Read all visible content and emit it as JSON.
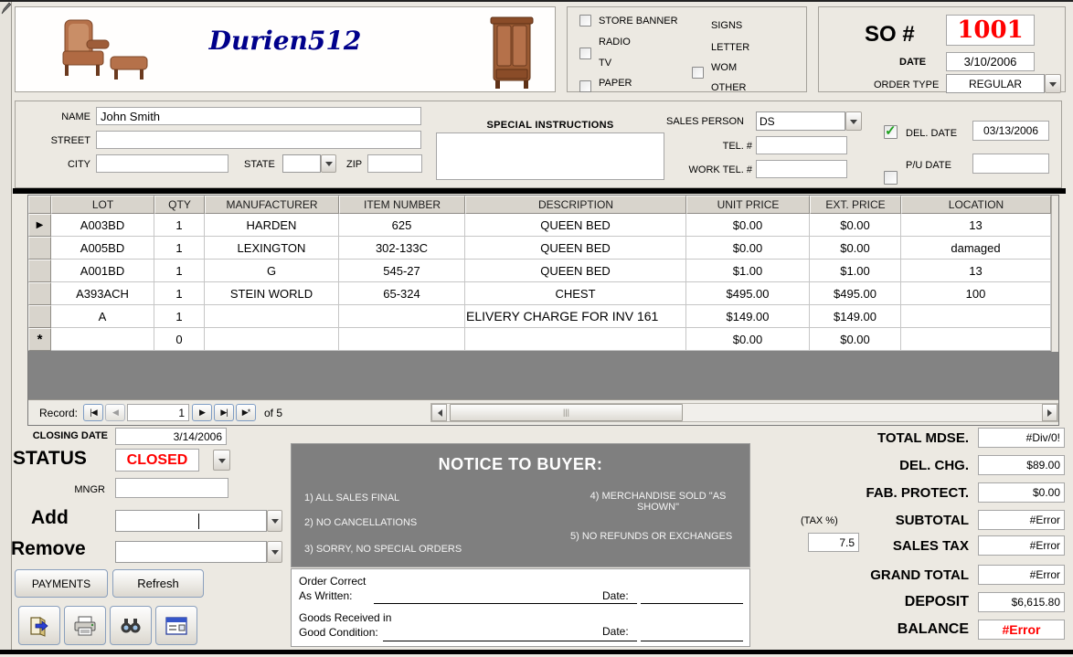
{
  "header": {
    "title": "Durien512",
    "images": [
      "armchair-image",
      "armoire-image"
    ],
    "checkboxes": [
      {
        "label": "STORE BANNER",
        "checked": false
      },
      {
        "label": "RADIO",
        "checked": false
      },
      {
        "label": "TV",
        "checked": false
      },
      {
        "label": "PAPER",
        "checked": false
      },
      {
        "label": "SIGNS",
        "checked": false
      },
      {
        "label": "LETTER",
        "checked": false
      },
      {
        "label": "WOM",
        "checked": true
      },
      {
        "label": "OTHER",
        "checked": false
      }
    ],
    "so": {
      "label": "SO #",
      "value": "1001"
    },
    "date": {
      "label": "DATE",
      "value": "3/10/2006"
    },
    "order_type": {
      "label": "ORDER TYPE",
      "value": "REGULAR"
    }
  },
  "customer": {
    "name": {
      "label": "NAME",
      "value": "John Smith"
    },
    "street": {
      "label": "STREET",
      "value": ""
    },
    "city": {
      "label": "CITY",
      "value": ""
    },
    "state": {
      "label": "STATE",
      "value": ""
    },
    "zip": {
      "label": "ZIP",
      "value": ""
    },
    "special_instructions": {
      "label": "SPECIAL INSTRUCTIONS",
      "value": ""
    },
    "sales_person": {
      "label": "SALES PERSON",
      "value": "DS"
    },
    "tel": {
      "label": "TEL. #",
      "value": ""
    },
    "work_tel": {
      "label": "WORK TEL. #",
      "value": ""
    },
    "del_date": {
      "label": "DEL. DATE",
      "checked": true,
      "value": "03/13/2006"
    },
    "pu_date": {
      "label": "P/U DATE",
      "checked": false,
      "value": ""
    }
  },
  "grid": {
    "columns": [
      "LOT",
      "QTY",
      "MANUFACTURER",
      "ITEM NUMBER",
      "DESCRIPTION",
      "UNIT PRICE",
      "EXT. PRICE",
      "LOCATION"
    ],
    "rows": [
      {
        "selector": "▶",
        "lot": "A003BD",
        "qty": "1",
        "manufacturer": "HARDEN",
        "item_number": "625",
        "description": "QUEEN BED",
        "unit_price": "$0.00",
        "ext_price": "$0.00",
        "location": "13"
      },
      {
        "selector": "",
        "lot": "A005BD",
        "qty": "1",
        "manufacturer": "LEXINGTON",
        "item_number": "302-133C",
        "description": "QUEEN BED",
        "unit_price": "$0.00",
        "ext_price": "$0.00",
        "location": "damaged"
      },
      {
        "selector": "",
        "lot": "A001BD",
        "qty": "1",
        "manufacturer": "G",
        "item_number": "545-27",
        "description": "QUEEN BED",
        "unit_price": "$1.00",
        "ext_price": "$1.00",
        "location": "13"
      },
      {
        "selector": "",
        "lot": "A393ACH",
        "qty": "1",
        "manufacturer": "STEIN WORLD",
        "item_number": "65-324",
        "description": "CHEST",
        "unit_price": "$495.00",
        "ext_price": "$495.00",
        "location": "100"
      },
      {
        "selector": "",
        "lot": "A",
        "qty": "1",
        "manufacturer": "",
        "item_number": "",
        "description": "ELIVERY CHARGE FOR INV 161",
        "unit_price": "$149.00",
        "ext_price": "$149.00",
        "location": ""
      },
      {
        "selector": "*",
        "lot": "",
        "qty": "0",
        "manufacturer": "",
        "item_number": "",
        "description": "",
        "unit_price": "$0.00",
        "ext_price": "$0.00",
        "location": ""
      }
    ],
    "record_nav": {
      "label": "Record:",
      "value": "1",
      "of_label": "of 5",
      "first": "|◀",
      "prev": "◀",
      "next": "▶",
      "last": "▶|",
      "new_rec": "▶*"
    }
  },
  "left_panel": {
    "closing_date": {
      "label": "CLOSING DATE",
      "value": "3/14/2006"
    },
    "status": {
      "label": "STATUS",
      "value": "CLOSED"
    },
    "mngr": {
      "label": "MNGR",
      "value": ""
    },
    "add": {
      "label": "Add",
      "value": ""
    },
    "remove": {
      "label": "Remove",
      "value": ""
    },
    "payments_button": "PAYMENTS",
    "refresh_button": "Refresh",
    "icon_buttons": [
      "exit-icon",
      "print-icon",
      "find-icon",
      "form-view-icon"
    ]
  },
  "notice": {
    "title": "NOTICE TO BUYER:",
    "left_items": [
      "1) ALL SALES FINAL",
      "2) NO CANCELLATIONS",
      "3) SORRY, NO SPECIAL ORDERS"
    ],
    "right_items": [
      "4)  MERCHANDISE SOLD \"AS SHOWN\"",
      "5) NO REFUNDS OR EXCHANGES"
    ]
  },
  "signature": {
    "order_correct_line1": "Order Correct",
    "order_correct_line2": "As Written:",
    "date_label": "Date:",
    "goods_line1": "Goods Received in",
    "goods_line2": "Good Condition:",
    "date_label2": "Date:"
  },
  "totals": {
    "tax_label": "(TAX %)",
    "tax_value": "7.5",
    "rows": [
      {
        "label": "TOTAL MDSE.",
        "value": "#Div/0!"
      },
      {
        "label": "DEL. CHG.",
        "value": "$89.00"
      },
      {
        "label": "FAB. PROTECT.",
        "value": "$0.00"
      },
      {
        "label": "SUBTOTAL",
        "value": "#Error"
      },
      {
        "label": "SALES TAX",
        "value": "#Error"
      },
      {
        "label": "GRAND TOTAL",
        "value": "#Error"
      },
      {
        "label": "DEPOSIT",
        "value": "$6,615.80"
      },
      {
        "label": "BALANCE",
        "value": "#Error"
      }
    ]
  },
  "colors": {
    "so_number": "#ff0000",
    "status_closed": "#ff0000",
    "balance_error": "#ff0000",
    "title_blue": "#00008b",
    "notice_bg": "#7f7f7f"
  }
}
